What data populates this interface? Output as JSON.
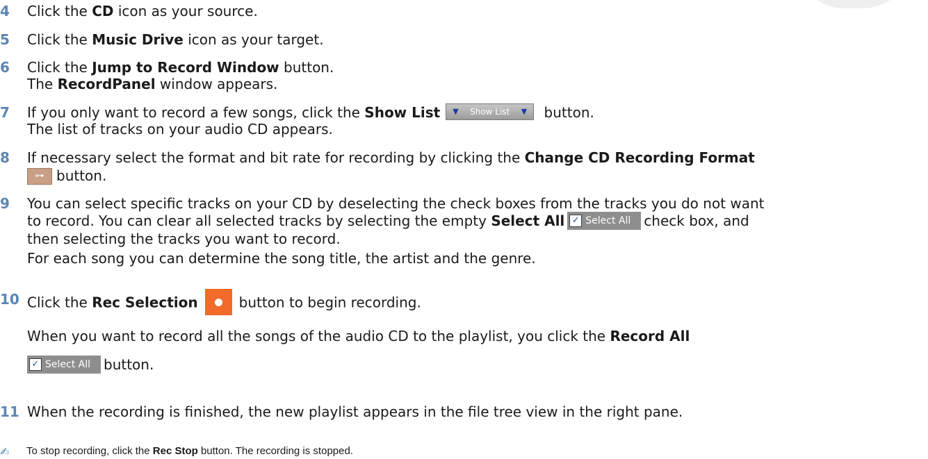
{
  "steps": [
    {
      "num": "4",
      "pre": "Click the ",
      "bold": "CD",
      "post": " icon as your source."
    },
    {
      "num": "5",
      "pre": "Click the ",
      "bold": "Music Drive",
      "post": " icon as your target."
    },
    {
      "num": "6",
      "pre": "Click the ",
      "bold": "Jump to Record Window",
      "post": " button.",
      "sub_pre": "The ",
      "sub_bold": "RecordPanel",
      "sub_post": " window appears."
    },
    {
      "num": "7",
      "pre": "If you only want to record a few songs, click the ",
      "bold": "Show List",
      "post": " button.",
      "sub": "The list of tracks on your audio CD appears."
    },
    {
      "num": "8",
      "pre": "If necessary select the format and bit rate for recording by clicking the ",
      "bold": "Change CD Recording Format",
      "post2": "button."
    },
    {
      "num": "9",
      "line1": "You can select specific tracks on your CD by deselecting the check boxes from the tracks you do not want",
      "line2_pre": "to record. You can clear all selected tracks by selecting the empty ",
      "line2_bold": "Select All",
      "line2_post": "check box, and",
      "line3": "then selecting the tracks you want to record.",
      "line4": "For each song you can determine the song title, the artist and the genre."
    },
    {
      "num": "10",
      "pre": "Click the ",
      "bold": "Rec Selection",
      "post": "button to begin recording.",
      "sub_pre": "When you want to record all the songs of the audio CD to the playlist, you click the ",
      "sub_bold": "Record All",
      "sub2": "button."
    },
    {
      "num": "11",
      "text": "When the recording is finished, the new playlist appears in the file tree view in the right pane."
    }
  ],
  "icons": {
    "show_list_label": "Show List",
    "select_all_label": "Select All",
    "show_list_arrow": "▼",
    "wrench_glyph": "⊶",
    "check_glyph": "✓",
    "note_glyph": "✍"
  },
  "note": {
    "pre": "To stop recording, click the ",
    "bold": "Rec Stop",
    "post": " button. The recording is stopped."
  }
}
